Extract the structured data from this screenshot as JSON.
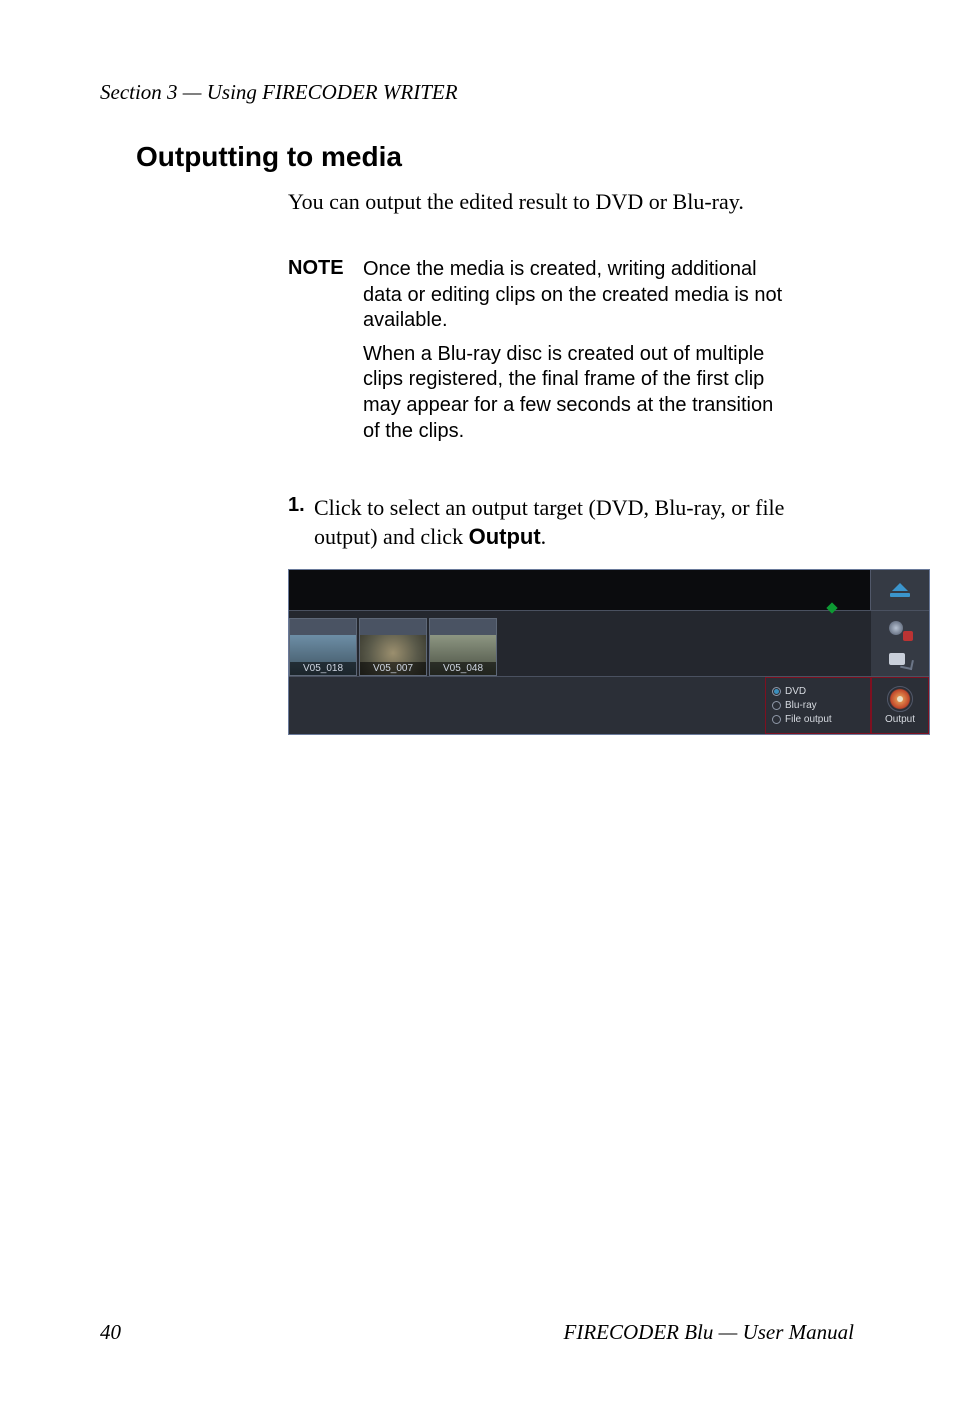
{
  "header": {
    "running": "Section 3 — Using FIRECODER WRITER"
  },
  "heading": "Outputting to media",
  "intro": "You can output the edited result to DVD or Blu-ray.",
  "note": {
    "label": "NOTE",
    "p1": "Once the media is created, writing additional data or editing clips on the created media is not available.",
    "p2": "When a Blu-ray disc is created out of multiple clips registered, the final frame of the first clip may appear for a few seconds at the transition of the clips."
  },
  "step": {
    "num": "1.",
    "text_before": "Click to select an output target (DVD, Blu-ray, or file output) and click ",
    "ui_word": "Output",
    "text_after": "."
  },
  "screenshot": {
    "clips": [
      {
        "label": "V05_018"
      },
      {
        "label": "V05_007"
      },
      {
        "label": "V05_048"
      }
    ],
    "options": {
      "dvd": "DVD",
      "bluray": "Blu-ray",
      "file": "File output",
      "selected": "dvd"
    },
    "output_label": "Output"
  },
  "footer": {
    "page_number": "40",
    "product": "FIRECODER Blu",
    "sep": "  —  ",
    "doc": "User Manual"
  }
}
